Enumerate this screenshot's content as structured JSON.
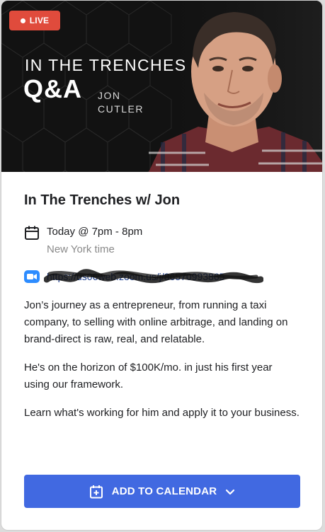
{
  "banner": {
    "live_label": "LIVE",
    "title": "IN THE TRENCHES",
    "qa": "Q&A",
    "name_first": "JON",
    "name_last": "CUTLER"
  },
  "event": {
    "title": "In The Trenches w/ Jon",
    "time": "Today @ 7pm - 8pm",
    "timezone": "New York time",
    "zoom_link": "https://us06web.zoom.us/j/86570993865",
    "description": [
      "Jon’s journey as a entrepreneur, from running a taxi company, to selling with online arbitrage, and landing on brand-direct is raw, real, and relatable.",
      "He's on the horizon of $100K/mo. in just his first year using our framework.",
      "Learn what's working for him and apply it to your business."
    ]
  },
  "cta": {
    "label": "ADD TO CALENDAR"
  },
  "icons": {
    "calendar": "calendar-icon",
    "zoom": "zoom-video-icon",
    "add_calendar": "calendar-plus-icon",
    "chevron": "chevron-down-icon"
  },
  "colors": {
    "live": "#e04b3c",
    "cta": "#4169e1",
    "zoom": "#2d8cff"
  }
}
